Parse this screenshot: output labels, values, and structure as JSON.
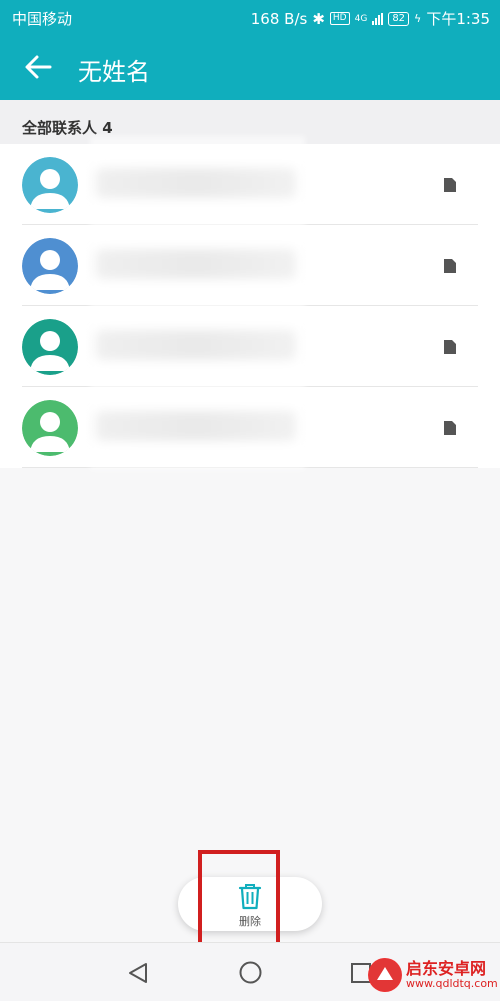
{
  "status_bar": {
    "carrier": "中国移动",
    "speed": "168 B/s",
    "hd_label": "HD",
    "net_label": "4G",
    "battery": "82",
    "time": "下午1:35"
  },
  "app_bar": {
    "title": "无姓名"
  },
  "section": {
    "header": "全部联系人  4"
  },
  "contacts": [
    {
      "avatar_color": "#4ab4d0"
    },
    {
      "avatar_color": "#4f8fd1"
    },
    {
      "avatar_color": "#1aa08a"
    },
    {
      "avatar_color": "#4cbb6e"
    }
  ],
  "action": {
    "delete_label": "删除"
  },
  "watermark": {
    "name": "启东安卓网",
    "url": "www.qdldtq.com"
  },
  "colors": {
    "accent": "#10aebd",
    "highlight": "#d11f1f"
  }
}
